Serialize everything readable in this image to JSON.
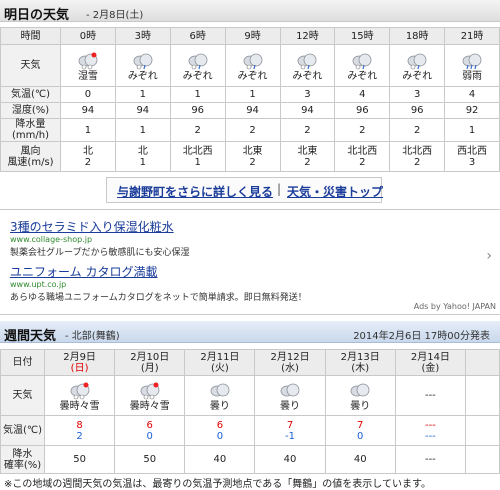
{
  "tomorrow": {
    "title": "明日の天気",
    "date_label": "- 2月8日(土)",
    "row_labels": {
      "time": "時間",
      "weather": "天気",
      "temp": "気温(℃)",
      "humidity": "湿度(%)",
      "precip": "降水量(mm/h)",
      "wind_dir": "風向",
      "wind_speed": "風速(m/s)"
    },
    "hours": [
      {
        "time": "0時",
        "weather": "湿雪",
        "icon": "wet-snow-icon",
        "temp": "0",
        "humidity": "94",
        "precip": "1",
        "wind_dir": "北",
        "wind_speed": "2"
      },
      {
        "time": "3時",
        "weather": "みぞれ",
        "icon": "sleet-icon",
        "temp": "1",
        "humidity": "94",
        "precip": "1",
        "wind_dir": "北",
        "wind_speed": "1"
      },
      {
        "time": "6時",
        "weather": "みぞれ",
        "icon": "sleet-icon",
        "temp": "1",
        "humidity": "96",
        "precip": "2",
        "wind_dir": "北北西",
        "wind_speed": "1"
      },
      {
        "time": "9時",
        "weather": "みぞれ",
        "icon": "sleet-icon",
        "temp": "1",
        "humidity": "94",
        "precip": "2",
        "wind_dir": "北東",
        "wind_speed": "2"
      },
      {
        "time": "12時",
        "weather": "みぞれ",
        "icon": "sleet-icon",
        "temp": "3",
        "humidity": "94",
        "precip": "2",
        "wind_dir": "北東",
        "wind_speed": "2"
      },
      {
        "time": "15時",
        "weather": "みぞれ",
        "icon": "sleet-icon",
        "temp": "4",
        "humidity": "96",
        "precip": "2",
        "wind_dir": "北北西",
        "wind_speed": "2"
      },
      {
        "time": "18時",
        "weather": "みぞれ",
        "icon": "sleet-icon",
        "temp": "3",
        "humidity": "96",
        "precip": "2",
        "wind_dir": "北北西",
        "wind_speed": "2"
      },
      {
        "time": "21時",
        "weather": "弱雨",
        "icon": "light-rain-icon",
        "temp": "4",
        "humidity": "92",
        "precip": "1",
        "wind_dir": "西北西",
        "wind_speed": "3"
      }
    ]
  },
  "links": {
    "detail": "与謝野町をさらに詳しく見る",
    "separator": "|",
    "disaster": "天気・災害トップ"
  },
  "ads": {
    "items": [
      {
        "title": "3種のセラミド入り保湿化粧水",
        "url": "www.collage-shop.jp",
        "desc": "製薬会社グループだから敏感肌にも安心保湿"
      },
      {
        "title": "ユニフォーム カタログ満載",
        "url": "www.upt.co.jp",
        "desc": "あらゆる職場ユニフォームカタログをネットで簡単請求。即日無料発送！"
      }
    ],
    "arrow": "›",
    "provider": "Ads by Yahoo! JAPAN"
  },
  "weekly": {
    "title": "週間天気",
    "region": "- 北部(舞鶴)",
    "announce": "2014年2月6日  17時00分発表",
    "row_labels": {
      "date": "日付",
      "weather": "天気",
      "temp": "気温(℃)",
      "precip_l1": "降水",
      "precip_l2": "確率(%)"
    },
    "days": [
      {
        "date": "2月9日",
        "dow": "(日)",
        "weather": "曇時々雪",
        "icon": "cloudy-snow-icon",
        "high": "8",
        "low": "2",
        "precip": "50"
      },
      {
        "date": "2月10日",
        "dow": "(月)",
        "weather": "曇時々雪",
        "icon": "cloudy-snow-icon",
        "high": "6",
        "low": "0",
        "precip": "50"
      },
      {
        "date": "2月11日",
        "dow": "(火)",
        "weather": "曇り",
        "icon": "cloudy-icon",
        "high": "6",
        "low": "0",
        "precip": "40"
      },
      {
        "date": "2月12日",
        "dow": "(水)",
        "weather": "曇り",
        "icon": "cloudy-icon",
        "high": "7",
        "low": "-1",
        "precip": "40"
      },
      {
        "date": "2月13日",
        "dow": "(木)",
        "weather": "曇り",
        "icon": "cloudy-icon",
        "high": "7",
        "low": "0",
        "precip": "40"
      },
      {
        "date": "2月14日",
        "dow": "(金)",
        "weather": "---",
        "icon": "",
        "high": "---",
        "low": "---",
        "precip": "---"
      }
    ]
  },
  "footnote": "※この地域の週間天気の気温は、最寄りの気温予測地点である「舞鶴」の値を表示しています。",
  "colors": {
    "high": "#e00000",
    "low": "#1a5fd6",
    "sunday": "#e00000",
    "link": "#1a3c9a",
    "ad_url": "#2f8a2f"
  }
}
